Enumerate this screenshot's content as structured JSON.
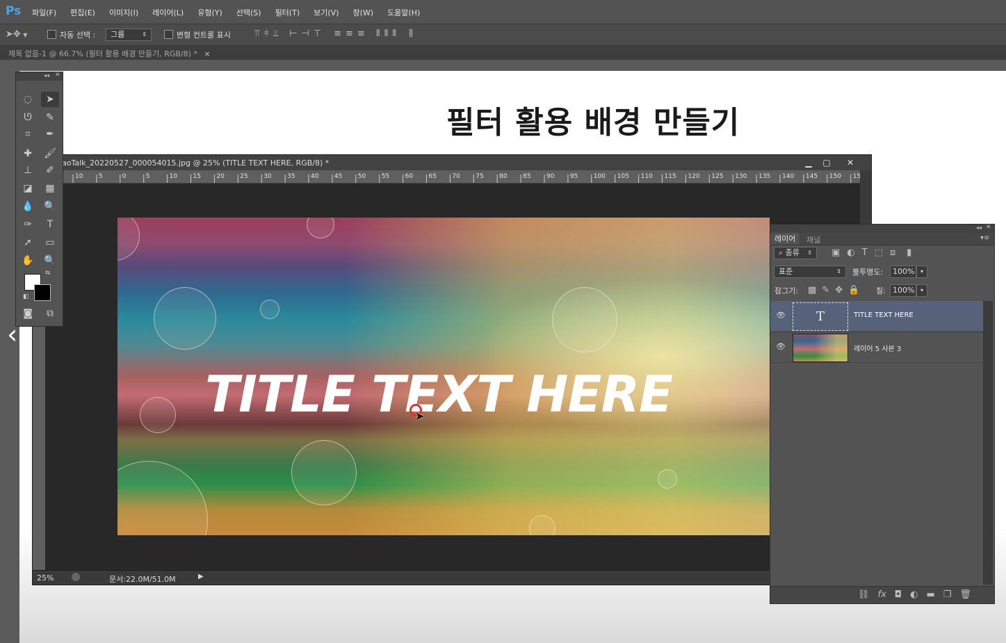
{
  "app": {
    "logo": "Ps"
  },
  "menu": [
    "파일(F)",
    "편집(E)",
    "이미지(I)",
    "레이어(L)",
    "유형(Y)",
    "선택(S)",
    "필터(T)",
    "보기(V)",
    "창(W)",
    "도움말(H)"
  ],
  "options_bar": {
    "auto_select_label": "자동 선택 :",
    "auto_select_value": "그룹",
    "show_transform_label": "변형 컨트롤 표시"
  },
  "doc_tab": {
    "label": "제목 없음-1 @ 66.7% (필터 활용 배경 만들기, RGB/8) *"
  },
  "main_canvas": {
    "heading": "필터 활용 배경 만들기"
  },
  "nested_window": {
    "title": "aoTalk_20220527_000054015.jpg @ 25% (TITLE TEXT HERE, RGB/8) *",
    "ruler_ticks": [
      "10",
      "5",
      "0",
      "5",
      "10",
      "15",
      "20",
      "25",
      "30",
      "35",
      "40",
      "45",
      "50",
      "55",
      "60",
      "65",
      "70",
      "75",
      "80",
      "85",
      "90",
      "95",
      "100",
      "105",
      "110",
      "115",
      "120",
      "125",
      "130",
      "135",
      "140",
      "145",
      "150",
      "15"
    ],
    "banner_text": "TITLE TEXT HERE",
    "zoom": "25%",
    "doc_size": "문서:22.0M/51.0M"
  },
  "layers_panel": {
    "tabs": [
      "레이어",
      "채널"
    ],
    "filter_kind": "종류",
    "blend_mode": "표준",
    "opacity_label": "불투명도:",
    "opacity_value": "100%",
    "lock_label": "잠그기:",
    "fill_label": "칠:",
    "fill_value": "100%",
    "layers": [
      {
        "name": "TITLE TEXT HERE",
        "type": "text",
        "selected": true
      },
      {
        "name": "레이어 5 사본 3",
        "type": "image",
        "selected": false
      }
    ]
  },
  "colors": {
    "foreground": "#ffffff",
    "background": "#000000",
    "selection": "#55627a",
    "ps_blue": "#4aa3e8"
  }
}
